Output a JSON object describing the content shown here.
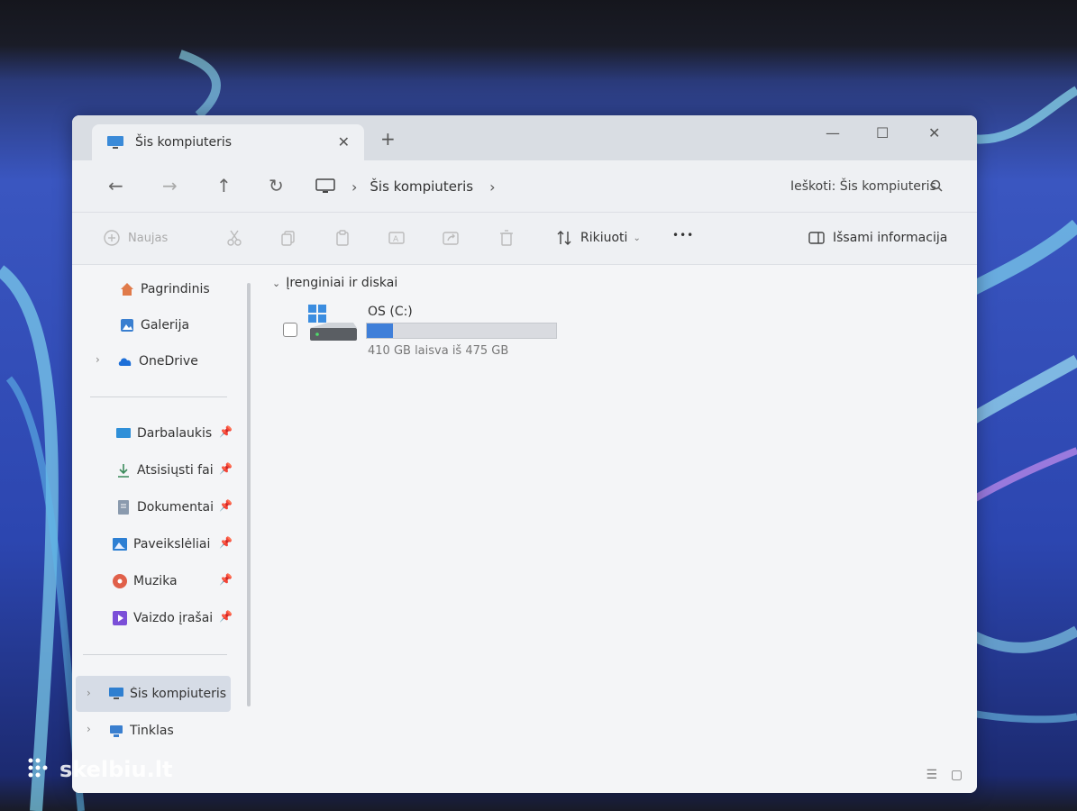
{
  "tab": {
    "title": "Šis kompiuteris",
    "close": "✕",
    "new": "+"
  },
  "window_controls": {
    "minimize": "—",
    "maximize": "☐",
    "close": "✕"
  },
  "nav": {
    "back": "←",
    "forward": "→",
    "up": "↑",
    "refresh": "↻",
    "breadcrumb": [
      "Šis kompiuteris"
    ],
    "separator": "›",
    "search_placeholder": "Ieškoti: Šis kompiuteris"
  },
  "toolbar": {
    "new_label": "Naujas",
    "sort_label": "Rikiuoti",
    "more_label": "•••",
    "details_label": "Išsami informacija"
  },
  "sidebar": {
    "top": [
      {
        "label": "Pagrindinis",
        "icon": "home-icon"
      },
      {
        "label": "Galerija",
        "icon": "gallery-icon"
      },
      {
        "label": "OneDrive",
        "icon": "cloud-icon"
      }
    ],
    "quick": [
      {
        "label": "Darbalaukis",
        "icon": "desktop-icon"
      },
      {
        "label": "Atsisiųsti failai",
        "icon": "download-icon"
      },
      {
        "label": "Dokumentai",
        "icon": "documents-icon"
      },
      {
        "label": "Paveikslėliai",
        "icon": "pictures-icon"
      },
      {
        "label": "Muzika",
        "icon": "music-icon"
      },
      {
        "label": "Vaizdo įrašai",
        "icon": "videos-icon"
      }
    ],
    "bottom": [
      {
        "label": "Šis kompiuteris",
        "icon": "pc-icon"
      },
      {
        "label": "Tinklas",
        "icon": "network-icon"
      }
    ]
  },
  "content": {
    "group_label": "Įrenginiai ir diskai",
    "drive": {
      "name": "OS (C:)",
      "free_text": "410 GB laisva iš 475 GB",
      "used_fraction": 0.137
    }
  },
  "watermark": "skelbiu.lt",
  "colors": {
    "accent": "#3f7fd9",
    "window_bg": "#f1f2f5"
  }
}
